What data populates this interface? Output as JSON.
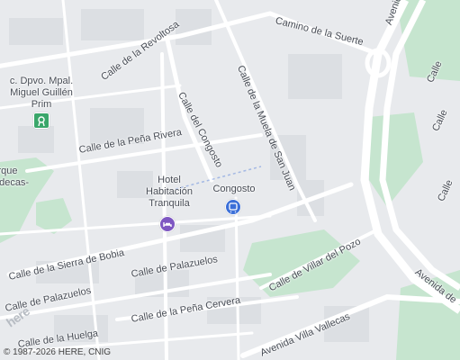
{
  "map": {
    "colors": {
      "land": "#e8eaed",
      "park": "#c6e5cf",
      "road": "#ffffff",
      "block": "#dcdfe3",
      "transit": "#3b6fd8",
      "hotel": "#7e57c2"
    },
    "streets": [
      {
        "name": "Camino de la Suerte"
      },
      {
        "name": "Calle de la Revoltosa"
      },
      {
        "name": "Calle de la Muela de San Juan"
      },
      {
        "name": "Calle del Congosto"
      },
      {
        "name": "Calle de la Peña Rivera"
      },
      {
        "name": "Calle de la Sierra de Bobia"
      },
      {
        "name": "Calle de Palazuelos"
      },
      {
        "name": "Calle de Palazuelos"
      },
      {
        "name": "Calle de la Huelga"
      },
      {
        "name": "Calle de la Peña Cervera"
      },
      {
        "name": "Calle de Villar del Pozo"
      },
      {
        "name": "Avenida Villa Vallecas"
      },
      {
        "name": "Avenida de"
      },
      {
        "name": "Avenida"
      },
      {
        "name": "Calle"
      },
      {
        "name": "Calle"
      },
      {
        "name": "Calle"
      }
    ],
    "pois": [
      {
        "name": "c. Dpvo. Mpal.\nMiguel Guillén\nPrim",
        "icon": "sports-center-icon"
      },
      {
        "name": "Hotel\nHabitación\nTranquila",
        "icon": "hotel-icon"
      },
      {
        "name": "Congosto",
        "icon": "metro-station-icon"
      },
      {
        "name": "Parque\nValdecas-",
        "icon": ""
      }
    ],
    "logo": "here",
    "attribution": "© 1987-2026 HERE, CNIG"
  }
}
